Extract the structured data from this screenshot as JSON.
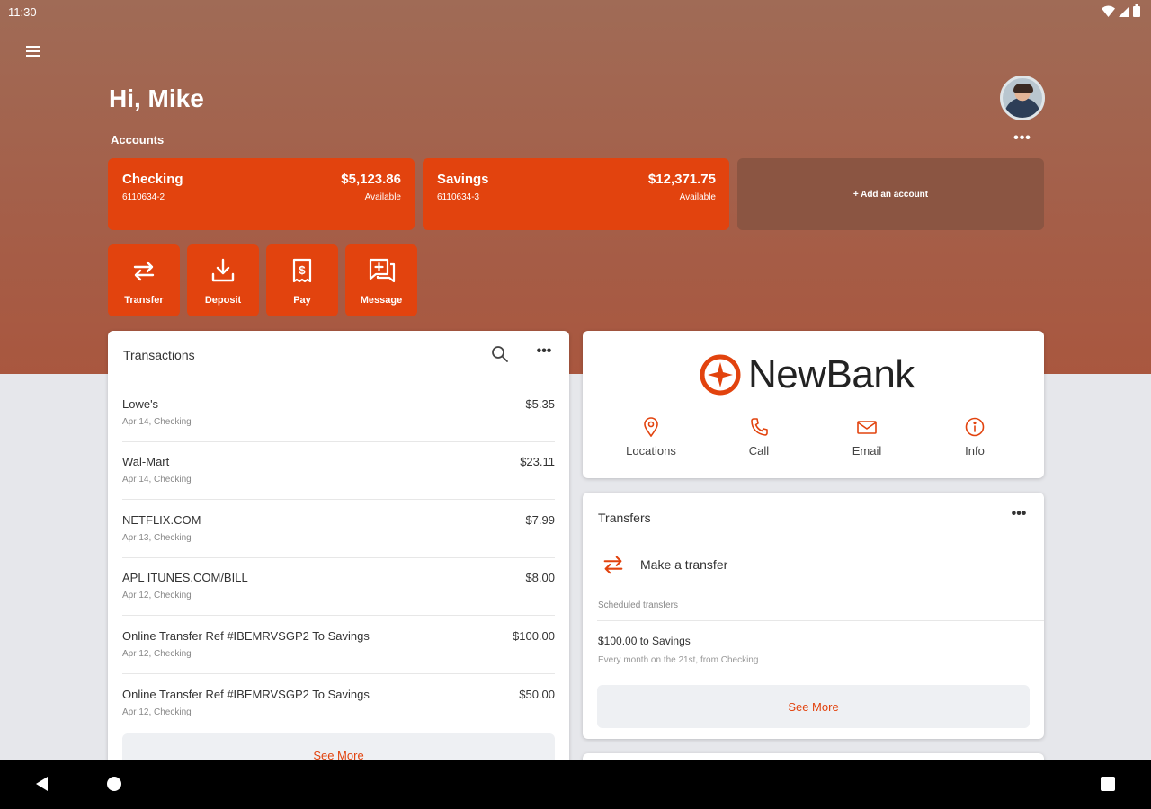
{
  "status_bar": {
    "time": "11:30",
    "icons": [
      "wifi-icon",
      "signal-icon",
      "battery-icon"
    ]
  },
  "colors": {
    "brand": "#e2430e",
    "hero": "#a55e48",
    "add_account_bg": "#8b5542",
    "card_bg": "#ffffff",
    "page_bg": "#e6e7eb"
  },
  "header": {
    "greeting": "Hi, Mike",
    "menu_icon": "menu-icon",
    "avatar": "user-avatar"
  },
  "accounts": {
    "label": "Accounts",
    "more": "•••",
    "items": [
      {
        "name": "Checking",
        "number": "6110634-2",
        "balance": "$5,123.86",
        "status": "Available"
      },
      {
        "name": "Savings",
        "number": "6110634-3",
        "balance": "$12,371.75",
        "status": "Available"
      }
    ],
    "add_label": "+ Add an account"
  },
  "actions": [
    {
      "label": "Transfer",
      "icon": "transfer-icon"
    },
    {
      "label": "Deposit",
      "icon": "deposit-icon"
    },
    {
      "label": "Pay",
      "icon": "bill-pay-icon"
    },
    {
      "label": "Message",
      "icon": "message-icon"
    }
  ],
  "transactions": {
    "title": "Transactions",
    "more": "•••",
    "items": [
      {
        "name": "Lowe's",
        "sub": "Apr 14, Checking",
        "amount": "$5.35"
      },
      {
        "name": "Wal-Mart",
        "sub": "Apr 14, Checking",
        "amount": "$23.11"
      },
      {
        "name": "NETFLIX.COM",
        "sub": "Apr 13, Checking",
        "amount": "$7.99"
      },
      {
        "name": "APL ITUNES.COM/BILL",
        "sub": "Apr 12, Checking",
        "amount": "$8.00"
      },
      {
        "name": "Online Transfer Ref #IBEMRVSGP2 To Savings",
        "sub": "Apr 12, Checking",
        "amount": "$100.00"
      },
      {
        "name": "Online Transfer Ref #IBEMRVSGP2 To Savings",
        "sub": "Apr 12, Checking",
        "amount": "$50.00"
      }
    ],
    "see_more": "See More"
  },
  "bank": {
    "name": "NewBank",
    "actions": [
      {
        "label": "Locations",
        "icon": "location-pin-icon"
      },
      {
        "label": "Call",
        "icon": "phone-icon"
      },
      {
        "label": "Email",
        "icon": "email-icon"
      },
      {
        "label": "Info",
        "icon": "info-icon"
      }
    ]
  },
  "transfers": {
    "title": "Transfers",
    "more": "•••",
    "make_transfer": "Make a transfer",
    "scheduled_label": "Scheduled transfers",
    "scheduled": {
      "title": "$100.00 to Savings",
      "sub": "Every month on the 21st, from Checking"
    },
    "see_more": "See More"
  }
}
